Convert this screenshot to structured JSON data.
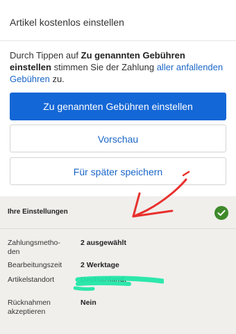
{
  "header": {
    "title": "Artikel kostenlos einstellen"
  },
  "consent": {
    "prefix": "Durch Tippen auf ",
    "bold": "Zu genannten Gebühren einstellen",
    "middle": " stimmen Sie der Zahlung ",
    "link": "aller anfallenden Gebühren",
    "suffix": " zu."
  },
  "buttons": {
    "primary": "Zu genannten Gebühren einstellen",
    "preview": "Vorschau",
    "save": "Für später speichern"
  },
  "settings": {
    "title": "Ihre Einstellungen",
    "rows": [
      {
        "label": "Zahlungsmetho-\nden",
        "value": "2 ausgewählt"
      },
      {
        "label": "Bearbeitungszeit",
        "value": "2 Werktage"
      },
      {
        "label": "Artikelstandort",
        "value": "Deutschland,"
      },
      {
        "label": "Rücknahmen\nakzeptieren",
        "value": "Nein"
      }
    ]
  },
  "colors": {
    "primary": "#1467d6",
    "link": "#1a66c7",
    "settings_bg": "#f0efec",
    "check": "#3e8a2a",
    "annotation_arrow": "#e8302d",
    "annotation_highlight": "#22e6a8"
  },
  "icons": {
    "status": "check-circle-icon"
  }
}
